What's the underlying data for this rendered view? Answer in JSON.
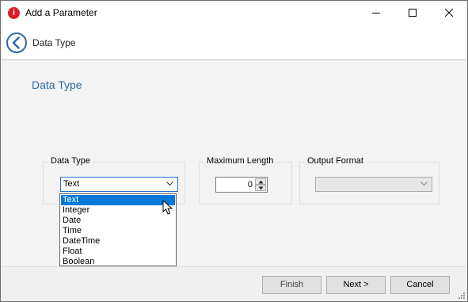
{
  "window": {
    "title": "Add a Parameter",
    "app_icon_letter": "i"
  },
  "header": {
    "title": "Data Type"
  },
  "page": {
    "title": "Data Type"
  },
  "data_type_group": {
    "label": "Data Type",
    "selected": "Text",
    "options": [
      "Text",
      "Integer",
      "Date",
      "Time",
      "DateTime",
      "Float",
      "Boolean"
    ]
  },
  "max_length_group": {
    "label": "Maximum Length",
    "value": "0"
  },
  "output_format_group": {
    "label": "Output Format",
    "value": ""
  },
  "footer": {
    "finish_label": "Finish",
    "next_label": "Next >",
    "cancel_label": "Cancel"
  },
  "colors": {
    "accent": "#2e6aa5",
    "selection": "#0078d7",
    "content_bg": "#f3f3f3"
  }
}
